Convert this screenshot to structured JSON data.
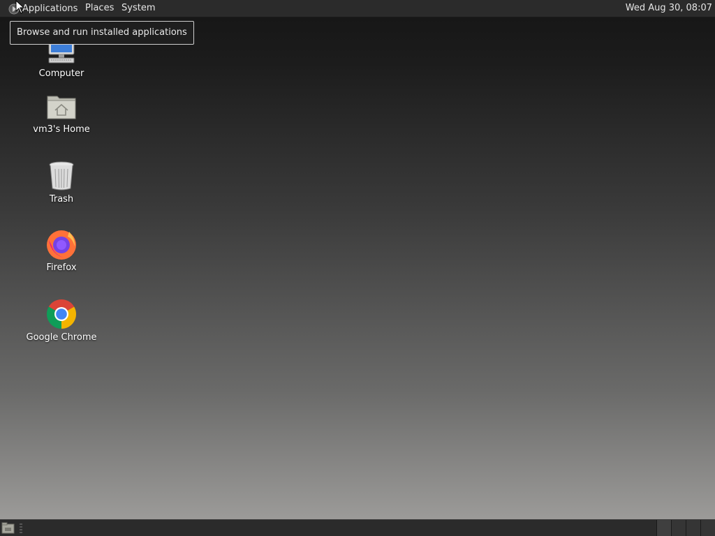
{
  "top_panel": {
    "applications_label": "Applications",
    "places_label": "Places",
    "system_label": "System",
    "clock": "Wed Aug 30, 08:07"
  },
  "tooltip": {
    "text": "Browse and run installed applications"
  },
  "desktop": {
    "icons": [
      {
        "label": "Computer",
        "icon": "computer-icon"
      },
      {
        "label": "vm3's Home",
        "icon": "home-folder-icon"
      },
      {
        "label": "Trash",
        "icon": "trash-icon"
      },
      {
        "label": "Firefox",
        "icon": "firefox-icon"
      },
      {
        "label": "Google Chrome",
        "icon": "chrome-icon"
      }
    ]
  },
  "bottom_panel": {
    "workspace_count": 4
  },
  "colors": {
    "panel_bg": "#2b2b2b",
    "panel_text": "#e6e6e6",
    "firefox_orange": "#ff7139",
    "chrome_red": "#db4437",
    "chrome_green": "#0f9d58",
    "chrome_yellow": "#f4b400",
    "chrome_blue": "#4285f4"
  }
}
